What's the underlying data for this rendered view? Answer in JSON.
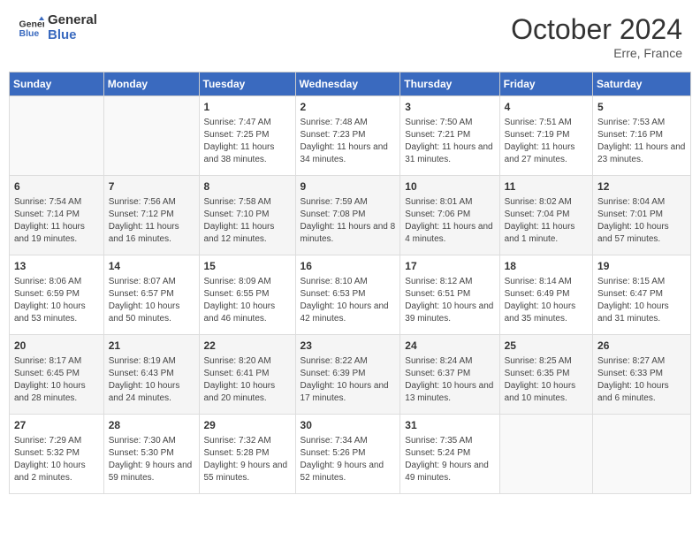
{
  "header": {
    "logo_line1": "General",
    "logo_line2": "Blue",
    "month_year": "October 2024",
    "location": "Erre, France"
  },
  "weekdays": [
    "Sunday",
    "Monday",
    "Tuesday",
    "Wednesday",
    "Thursday",
    "Friday",
    "Saturday"
  ],
  "weeks": [
    [
      {
        "day": "",
        "info": ""
      },
      {
        "day": "",
        "info": ""
      },
      {
        "day": "1",
        "info": "Sunrise: 7:47 AM\nSunset: 7:25 PM\nDaylight: 11 hours and 38 minutes."
      },
      {
        "day": "2",
        "info": "Sunrise: 7:48 AM\nSunset: 7:23 PM\nDaylight: 11 hours and 34 minutes."
      },
      {
        "day": "3",
        "info": "Sunrise: 7:50 AM\nSunset: 7:21 PM\nDaylight: 11 hours and 31 minutes."
      },
      {
        "day": "4",
        "info": "Sunrise: 7:51 AM\nSunset: 7:19 PM\nDaylight: 11 hours and 27 minutes."
      },
      {
        "day": "5",
        "info": "Sunrise: 7:53 AM\nSunset: 7:16 PM\nDaylight: 11 hours and 23 minutes."
      }
    ],
    [
      {
        "day": "6",
        "info": "Sunrise: 7:54 AM\nSunset: 7:14 PM\nDaylight: 11 hours and 19 minutes."
      },
      {
        "day": "7",
        "info": "Sunrise: 7:56 AM\nSunset: 7:12 PM\nDaylight: 11 hours and 16 minutes."
      },
      {
        "day": "8",
        "info": "Sunrise: 7:58 AM\nSunset: 7:10 PM\nDaylight: 11 hours and 12 minutes."
      },
      {
        "day": "9",
        "info": "Sunrise: 7:59 AM\nSunset: 7:08 PM\nDaylight: 11 hours and 8 minutes."
      },
      {
        "day": "10",
        "info": "Sunrise: 8:01 AM\nSunset: 7:06 PM\nDaylight: 11 hours and 4 minutes."
      },
      {
        "day": "11",
        "info": "Sunrise: 8:02 AM\nSunset: 7:04 PM\nDaylight: 11 hours and 1 minute."
      },
      {
        "day": "12",
        "info": "Sunrise: 8:04 AM\nSunset: 7:01 PM\nDaylight: 10 hours and 57 minutes."
      }
    ],
    [
      {
        "day": "13",
        "info": "Sunrise: 8:06 AM\nSunset: 6:59 PM\nDaylight: 10 hours and 53 minutes."
      },
      {
        "day": "14",
        "info": "Sunrise: 8:07 AM\nSunset: 6:57 PM\nDaylight: 10 hours and 50 minutes."
      },
      {
        "day": "15",
        "info": "Sunrise: 8:09 AM\nSunset: 6:55 PM\nDaylight: 10 hours and 46 minutes."
      },
      {
        "day": "16",
        "info": "Sunrise: 8:10 AM\nSunset: 6:53 PM\nDaylight: 10 hours and 42 minutes."
      },
      {
        "day": "17",
        "info": "Sunrise: 8:12 AM\nSunset: 6:51 PM\nDaylight: 10 hours and 39 minutes."
      },
      {
        "day": "18",
        "info": "Sunrise: 8:14 AM\nSunset: 6:49 PM\nDaylight: 10 hours and 35 minutes."
      },
      {
        "day": "19",
        "info": "Sunrise: 8:15 AM\nSunset: 6:47 PM\nDaylight: 10 hours and 31 minutes."
      }
    ],
    [
      {
        "day": "20",
        "info": "Sunrise: 8:17 AM\nSunset: 6:45 PM\nDaylight: 10 hours and 28 minutes."
      },
      {
        "day": "21",
        "info": "Sunrise: 8:19 AM\nSunset: 6:43 PM\nDaylight: 10 hours and 24 minutes."
      },
      {
        "day": "22",
        "info": "Sunrise: 8:20 AM\nSunset: 6:41 PM\nDaylight: 10 hours and 20 minutes."
      },
      {
        "day": "23",
        "info": "Sunrise: 8:22 AM\nSunset: 6:39 PM\nDaylight: 10 hours and 17 minutes."
      },
      {
        "day": "24",
        "info": "Sunrise: 8:24 AM\nSunset: 6:37 PM\nDaylight: 10 hours and 13 minutes."
      },
      {
        "day": "25",
        "info": "Sunrise: 8:25 AM\nSunset: 6:35 PM\nDaylight: 10 hours and 10 minutes."
      },
      {
        "day": "26",
        "info": "Sunrise: 8:27 AM\nSunset: 6:33 PM\nDaylight: 10 hours and 6 minutes."
      }
    ],
    [
      {
        "day": "27",
        "info": "Sunrise: 7:29 AM\nSunset: 5:32 PM\nDaylight: 10 hours and 2 minutes."
      },
      {
        "day": "28",
        "info": "Sunrise: 7:30 AM\nSunset: 5:30 PM\nDaylight: 9 hours and 59 minutes."
      },
      {
        "day": "29",
        "info": "Sunrise: 7:32 AM\nSunset: 5:28 PM\nDaylight: 9 hours and 55 minutes."
      },
      {
        "day": "30",
        "info": "Sunrise: 7:34 AM\nSunset: 5:26 PM\nDaylight: 9 hours and 52 minutes."
      },
      {
        "day": "31",
        "info": "Sunrise: 7:35 AM\nSunset: 5:24 PM\nDaylight: 9 hours and 49 minutes."
      },
      {
        "day": "",
        "info": ""
      },
      {
        "day": "",
        "info": ""
      }
    ]
  ]
}
